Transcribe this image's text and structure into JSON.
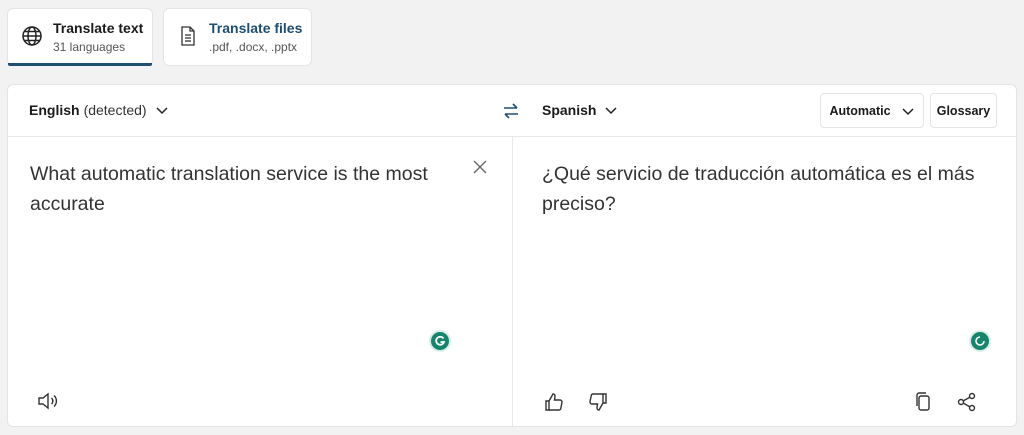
{
  "tabs": [
    {
      "label": "Translate text",
      "sub": "31 languages",
      "icon": "globe-icon",
      "active": true
    },
    {
      "label": "Translate files",
      "sub": ".pdf, .docx, .pptx",
      "icon": "document-icon",
      "active": false
    }
  ],
  "source": {
    "language": "English",
    "detected": "(detected)",
    "text": "What automatic translation service is the most accurate"
  },
  "target": {
    "language": "Spanish",
    "text": "¿Qué servicio de traducción automática es el más preciso?"
  },
  "controls": {
    "mode_label": "Automatic",
    "glossary_label": "Glossary"
  },
  "colors": {
    "accent": "#1e4e72",
    "grammarly": "#15866c"
  }
}
